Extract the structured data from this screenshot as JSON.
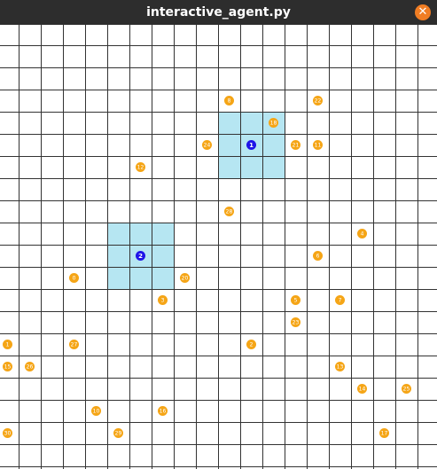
{
  "window": {
    "title": "interactive_agent.py",
    "close_icon": "close-icon",
    "close_glyph": "✕"
  },
  "grid": {
    "cols": 20,
    "rows": 20,
    "line_color": "#333333",
    "background": "#ffffff"
  },
  "colors": {
    "agent_fill": "#1f14e8",
    "agent_zone": "#b6e6f2",
    "target_fill": "#f5a516",
    "target_text": "#ffffff",
    "agent_text": "#ffffff"
  },
  "agents": [
    {
      "id": "1",
      "col": 11,
      "row": 5
    },
    {
      "id": "2",
      "col": 6,
      "row": 10
    }
  ],
  "targets": [
    {
      "id": "8",
      "col": 10,
      "row": 3
    },
    {
      "id": "22",
      "col": 14,
      "row": 3
    },
    {
      "id": "18",
      "col": 12,
      "row": 4
    },
    {
      "id": "24",
      "col": 9,
      "row": 5
    },
    {
      "id": "21",
      "col": 13,
      "row": 5
    },
    {
      "id": "11",
      "col": 14,
      "row": 5
    },
    {
      "id": "12",
      "col": 6,
      "row": 6
    },
    {
      "id": "28",
      "col": 10,
      "row": 8
    },
    {
      "id": "4",
      "col": 16,
      "row": 9
    },
    {
      "id": "6",
      "col": 14,
      "row": 10
    },
    {
      "id": "0",
      "col": 3,
      "row": 11
    },
    {
      "id": "20",
      "col": 8,
      "row": 11
    },
    {
      "id": "3",
      "col": 7,
      "row": 12
    },
    {
      "id": "5",
      "col": 13,
      "row": 12
    },
    {
      "id": "7",
      "col": 15,
      "row": 12
    },
    {
      "id": "23",
      "col": 13,
      "row": 13
    },
    {
      "id": "1",
      "col": 0,
      "row": 14
    },
    {
      "id": "27",
      "col": 3,
      "row": 14
    },
    {
      "id": "2",
      "col": 11,
      "row": 14
    },
    {
      "id": "15",
      "col": 0,
      "row": 15
    },
    {
      "id": "26",
      "col": 1,
      "row": 15
    },
    {
      "id": "13",
      "col": 15,
      "row": 15
    },
    {
      "id": "14",
      "col": 16,
      "row": 16
    },
    {
      "id": "25",
      "col": 18,
      "row": 16
    },
    {
      "id": "10",
      "col": 4,
      "row": 17
    },
    {
      "id": "16",
      "col": 7,
      "row": 17
    },
    {
      "id": "30",
      "col": 0,
      "row": 18
    },
    {
      "id": "29",
      "col": 5,
      "row": 18
    },
    {
      "id": "17",
      "col": 17,
      "row": 18
    }
  ]
}
